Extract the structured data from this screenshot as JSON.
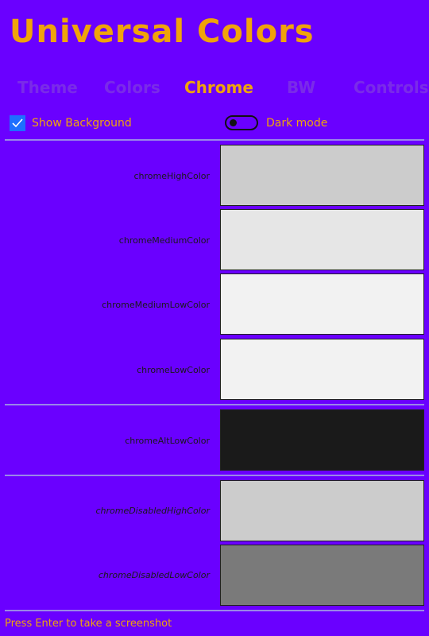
{
  "app": {
    "title": "Universal Colors"
  },
  "tabs": [
    {
      "label": "Theme",
      "active": false
    },
    {
      "label": "Colors",
      "active": false
    },
    {
      "label": "Chrome",
      "active": true
    },
    {
      "label": "BW",
      "active": false
    },
    {
      "label": "Controls",
      "active": false
    }
  ],
  "options": {
    "show_background": {
      "label": "Show Background",
      "checked": true
    },
    "dark_mode": {
      "label": "Dark mode",
      "on": false
    }
  },
  "swatches": [
    {
      "name": "chromeHighColor",
      "color": "#cccccc"
    },
    {
      "name": "chromeMediumColor",
      "color": "#e6e6e6"
    },
    {
      "name": "chromeMediumLowColor",
      "color": "#f2f2f2"
    },
    {
      "name": "chromeLowColor",
      "color": "#f2f2f2"
    },
    {
      "name": "chromeAltLowColor",
      "color": "#1a1a1a"
    },
    {
      "name": "chromeDisabledHighColor",
      "color": "#cccccc"
    },
    {
      "name": "chromeDisabledLowColor",
      "color": "#7a7a7a"
    }
  ],
  "footer": {
    "hint": "Press Enter to take a screenshot"
  },
  "colors": {
    "background": "#6a00ff",
    "accent": "#f0a30a",
    "inactive_tab": "#7a2be8",
    "checkbox": "#1e6fff"
  }
}
